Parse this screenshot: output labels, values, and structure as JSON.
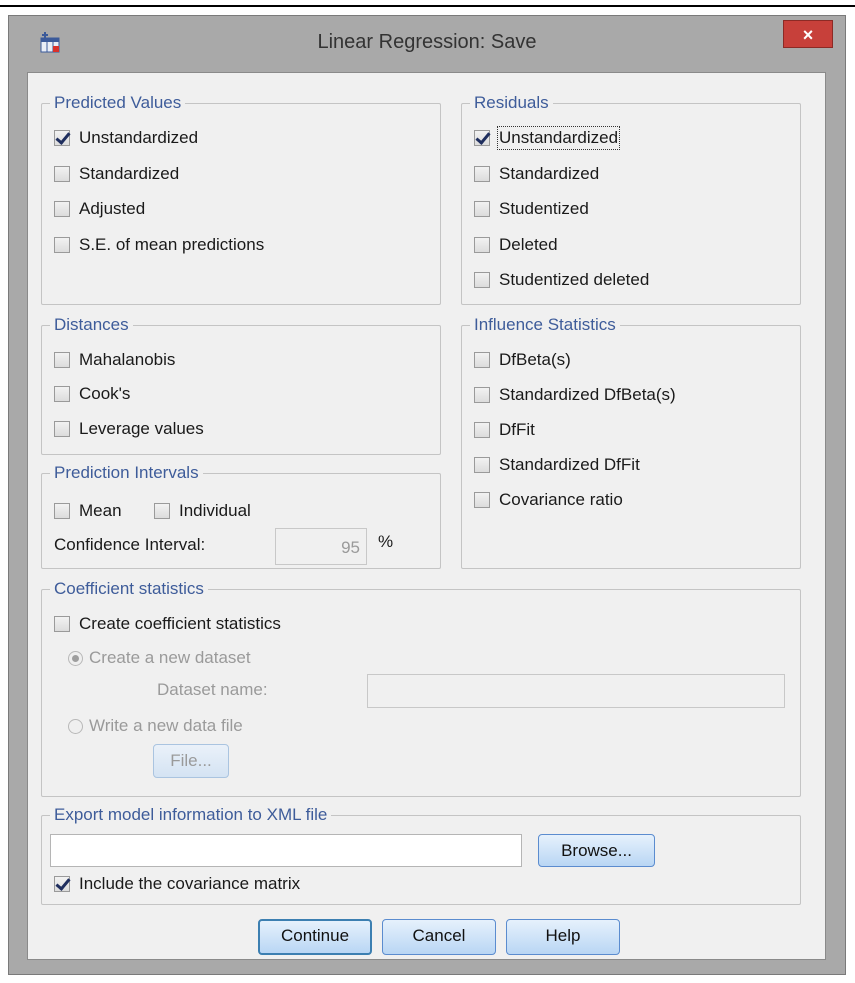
{
  "window": {
    "title": "Linear Regression: Save",
    "close_label": "×",
    "app_icon": "spss-table-icon"
  },
  "predicted_values": {
    "legend": "Predicted Values",
    "items": [
      {
        "label": "Unstandardized",
        "checked": true
      },
      {
        "label": "Standardized",
        "checked": false
      },
      {
        "label": "Adjusted",
        "checked": false
      },
      {
        "label": "S.E. of mean predictions",
        "checked": false
      }
    ]
  },
  "residuals": {
    "legend": "Residuals",
    "items": [
      {
        "label": "Unstandardized",
        "checked": true
      },
      {
        "label": "Standardized",
        "checked": false
      },
      {
        "label": "Studentized",
        "checked": false
      },
      {
        "label": "Deleted",
        "checked": false
      },
      {
        "label": "Studentized deleted",
        "checked": false
      }
    ]
  },
  "distances": {
    "legend": "Distances",
    "items": [
      {
        "label": "Mahalanobis",
        "checked": false
      },
      {
        "label": "Cook's",
        "checked": false
      },
      {
        "label": "Leverage values",
        "checked": false
      }
    ]
  },
  "influence_statistics": {
    "legend": "Influence Statistics",
    "items": [
      {
        "label": "DfBeta(s)",
        "checked": false
      },
      {
        "label": "Standardized DfBeta(s)",
        "checked": false
      },
      {
        "label": "DfFit",
        "checked": false
      },
      {
        "label": "Standardized DfFit",
        "checked": false
      },
      {
        "label": "Covariance ratio",
        "checked": false
      }
    ]
  },
  "prediction_intervals": {
    "legend": "Prediction Intervals",
    "mean_label": "Mean",
    "individual_label": "Individual",
    "ci_label": "Confidence Interval:",
    "ci_value": "95",
    "ci_unit": "%"
  },
  "coefficient_statistics": {
    "legend": "Coefficient statistics",
    "create_label": "Create coefficient statistics",
    "new_dataset_label": "Create a new dataset",
    "dataset_name_label": "Dataset name:",
    "dataset_name_value": "",
    "write_file_label": "Write a new data file",
    "file_button": "File..."
  },
  "export": {
    "legend": "Export model information to XML file",
    "path_value": "",
    "browse_button": "Browse...",
    "include_cov_label": "Include the covariance matrix",
    "include_cov_checked": true
  },
  "buttons": {
    "continue": "Continue",
    "cancel": "Cancel",
    "help": "Help"
  },
  "colors": {
    "legend_text": "#3e5c9a",
    "close_button": "#c7403a",
    "button_border": "#5b8ccf"
  }
}
